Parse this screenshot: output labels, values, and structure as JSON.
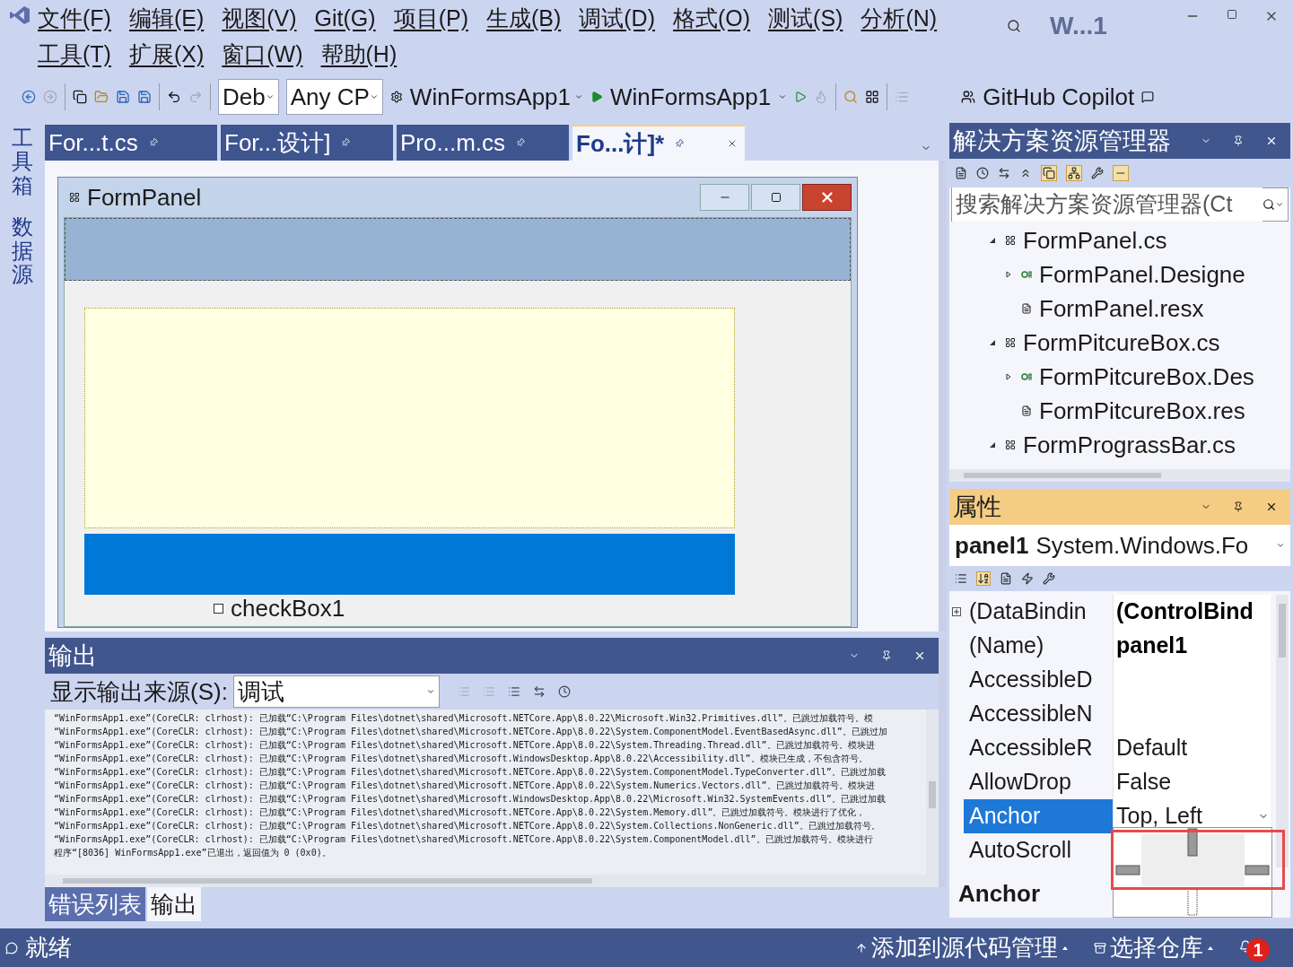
{
  "window": {
    "title": "W...1"
  },
  "menu": {
    "items": [
      "文件(F)",
      "编辑(E)",
      "视图(V)",
      "Git(G)",
      "项目(P)",
      "生成(B)",
      "调试(D)",
      "格式(O)",
      "测试(S)",
      "分析(N)",
      "工具(T)",
      "扩展(X)",
      "窗口(W)",
      "帮助(H)"
    ]
  },
  "toolbar": {
    "configuration": "Deb",
    "platform": "Any CP",
    "startup_project": "WinFormsApp1",
    "run_target": "WinFormsApp1",
    "copilot": "GitHub Copilot"
  },
  "side_strip": {
    "items": [
      "工具箱",
      "数据源"
    ]
  },
  "document_tabs": [
    {
      "label": "For...t.cs",
      "selected": false
    },
    {
      "label": "For...设计]",
      "selected": false
    },
    {
      "label": "Pro...m.cs",
      "selected": false
    },
    {
      "label": "Fo...计]*",
      "selected": true
    }
  ],
  "designer": {
    "form_title": "FormPanel",
    "checkbox": {
      "label": "checkBox1",
      "checked": false
    }
  },
  "output": {
    "title": "输出",
    "source_label": "显示输出来源(S):",
    "source_value": "调试",
    "lines": [
      "“WinFormsApp1.exe”(CoreCLR: clrhost): 已加载“C:\\Program Files\\dotnet\\shared\\Microsoft.NETCore.App\\8.0.22\\Microsoft.Win32.Primitives.dll”。已跳过加载符号。模",
      "“WinFormsApp1.exe”(CoreCLR: clrhost): 已加载“C:\\Program Files\\dotnet\\shared\\Microsoft.NETCore.App\\8.0.22\\System.ComponentModel.EventBasedAsync.dll”。已跳过加",
      "“WinFormsApp1.exe”(CoreCLR: clrhost): 已加载“C:\\Program Files\\dotnet\\shared\\Microsoft.NETCore.App\\8.0.22\\System.Threading.Thread.dll”。已跳过加载符号。模块进",
      "“WinFormsApp1.exe”(CoreCLR: clrhost): 已加载“C:\\Program Files\\dotnet\\shared\\Microsoft.WindowsDesktop.App\\8.0.22\\Accessibility.dll”。模块已生成，不包含符号。",
      "“WinFormsApp1.exe”(CoreCLR: clrhost): 已加载“C:\\Program Files\\dotnet\\shared\\Microsoft.NETCore.App\\8.0.22\\System.ComponentModel.TypeConverter.dll”。已跳过加载",
      "“WinFormsApp1.exe”(CoreCLR: clrhost): 已加载“C:\\Program Files\\dotnet\\shared\\Microsoft.NETCore.App\\8.0.22\\System.Numerics.Vectors.dll”。已跳过加载符号。模块进",
      "“WinFormsApp1.exe”(CoreCLR: clrhost): 已加载“C:\\Program Files\\dotnet\\shared\\Microsoft.WindowsDesktop.App\\8.0.22\\Microsoft.Win32.SystemEvents.dll”。已跳过加载",
      "“WinFormsApp1.exe”(CoreCLR: clrhost): 已加载“C:\\Program Files\\dotnet\\shared\\Microsoft.NETCore.App\\8.0.22\\System.Memory.dll”。已跳过加载符号。模块进行了优化，",
      "“WinFormsApp1.exe”(CoreCLR: clrhost): 已加载“C:\\Program Files\\dotnet\\shared\\Microsoft.NETCore.App\\8.0.22\\System.Collections.NonGeneric.dll”。已跳过加载符号。",
      "“WinFormsApp1.exe”(CoreCLR: clrhost): 已加载“C:\\Program Files\\dotnet\\shared\\Microsoft.NETCore.App\\8.0.22\\System.ComponentModel.dll”。已跳过加载符号。模块进行",
      "程序“[8036] WinFormsApp1.exe”已退出，返回值为 0 (0x0)。"
    ]
  },
  "bottom_tabs": [
    {
      "label": "错误列表",
      "selected": false
    },
    {
      "label": "输出",
      "selected": true
    }
  ],
  "solution_explorer": {
    "title": "解决方案资源管理器",
    "search": {
      "placeholder": "搜索解决方案资源管理器(Ct"
    },
    "tree": [
      {
        "label": "FormPanel.cs",
        "kind": "form",
        "expanded": true,
        "children": [
          {
            "label": "FormPanel.Designe",
            "kind": "code",
            "expanded": false
          },
          {
            "label": "FormPanel.resx",
            "kind": "resource"
          }
        ]
      },
      {
        "label": "FormPitcureBox.cs",
        "kind": "form",
        "expanded": true,
        "children": [
          {
            "label": "FormPitcureBox.Des",
            "kind": "code",
            "expanded": false
          },
          {
            "label": "FormPitcureBox.res",
            "kind": "resource"
          }
        ]
      },
      {
        "label": "FormPrograssBar.cs",
        "kind": "form",
        "expanded": true
      }
    ]
  },
  "properties": {
    "title": "属性",
    "object_name": "panel1",
    "object_type": "System.Windows.Fo",
    "rows": [
      {
        "name": "(DataBindin",
        "value": "(ControlBind",
        "kind": "group",
        "modified": true,
        "selected": false
      },
      {
        "name": "(Name)",
        "value": "panel1",
        "kind": "property",
        "modified": true,
        "selected": false
      },
      {
        "name": "AccessibleD",
        "kind": "property",
        "selected": false
      },
      {
        "name": "AccessibleN",
        "kind": "property",
        "selected": false
      },
      {
        "name": "AccessibleR",
        "value": "Default",
        "kind": "property",
        "modified": false,
        "selected": false
      },
      {
        "name": "AllowDrop",
        "value": "False",
        "kind": "property",
        "modified": false,
        "selected": false
      },
      {
        "name": "Anchor",
        "value": "Top, Left",
        "kind": "property",
        "modified": false,
        "selected": true
      },
      {
        "name": "AutoScroll",
        "kind": "property",
        "selected": false
      }
    ],
    "description_title": "Anchor"
  },
  "status_bar": {
    "status": "就绪",
    "source_control": "添加到源代码管理",
    "repository": "选择仓库",
    "notifications": "1"
  }
}
